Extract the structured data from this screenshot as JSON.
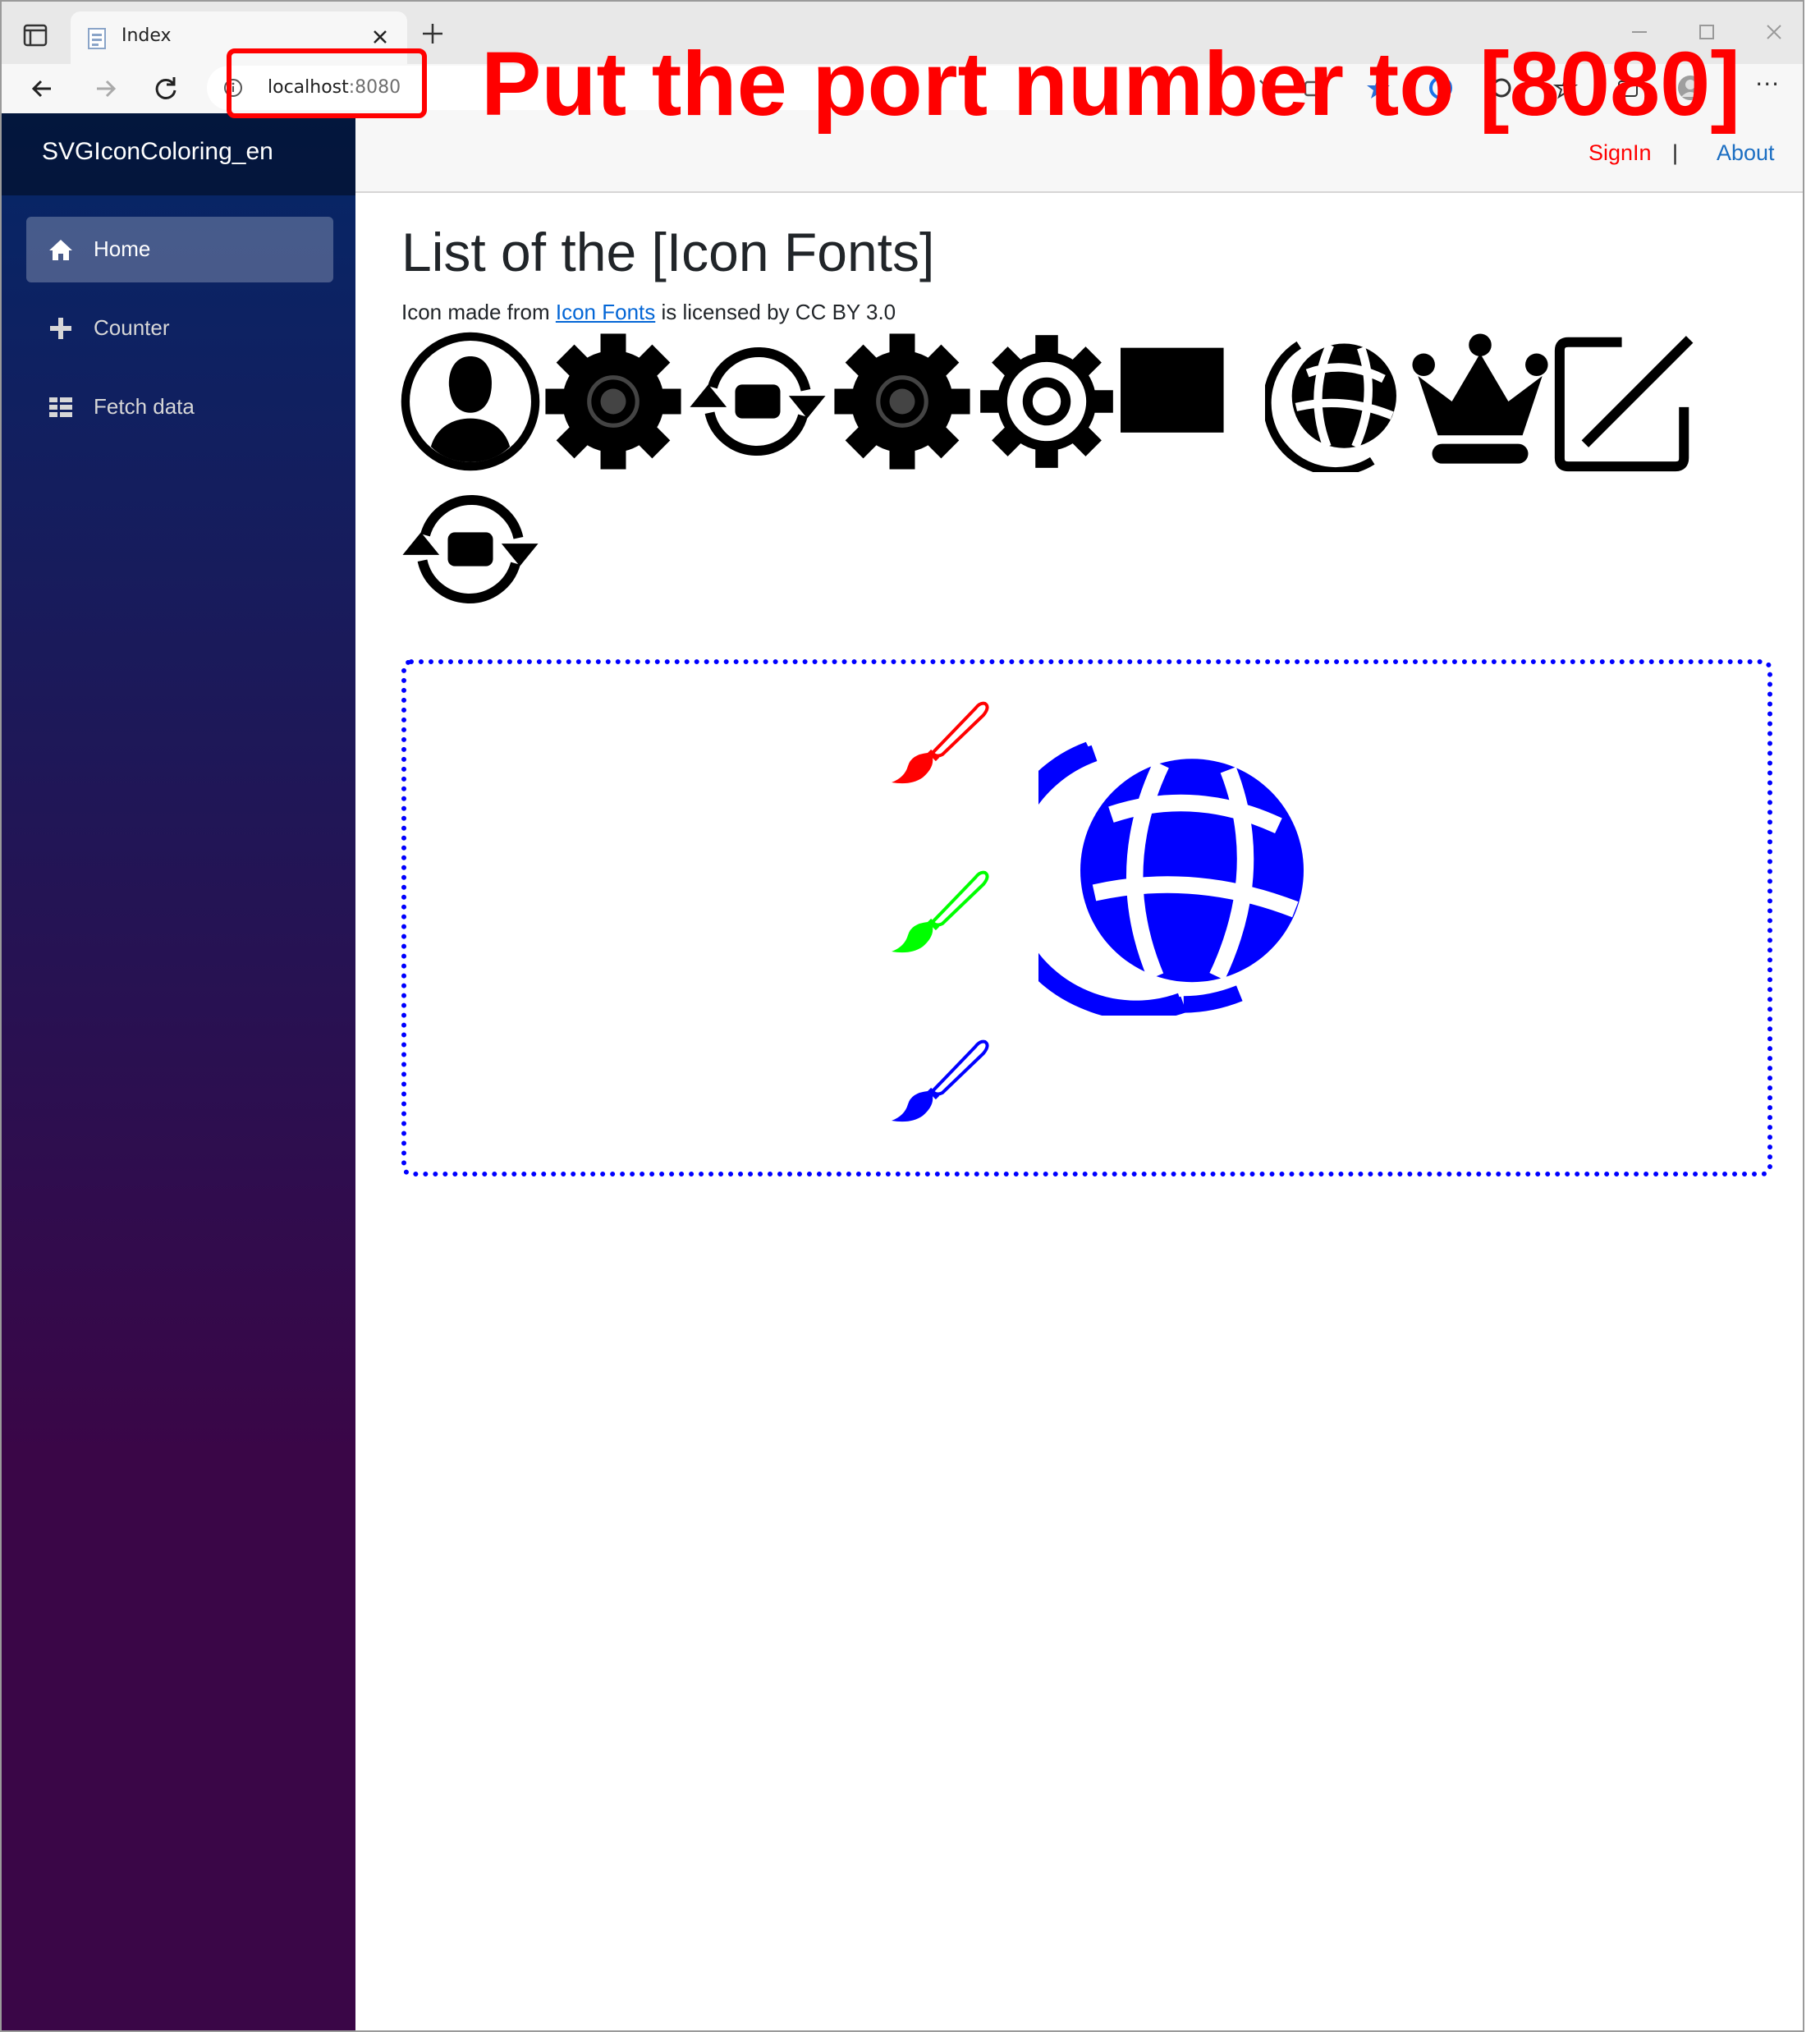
{
  "browser": {
    "tab_title": "Index",
    "url_host": "localhost",
    "url_port": ":8080",
    "more_label": "···"
  },
  "annotation": {
    "text": "Put the port number to [8080]",
    "color": "#ff0000"
  },
  "sidebar": {
    "brand": "SVGIconColoring_en",
    "items": [
      {
        "label": "Home",
        "icon": "home-icon",
        "active": true
      },
      {
        "label": "Counter",
        "icon": "plus-icon",
        "active": false
      },
      {
        "label": "Fetch data",
        "icon": "list-icon",
        "active": false
      }
    ],
    "gradient_top": "#052767",
    "gradient_bottom": "#3a0647"
  },
  "topbar": {
    "signin": "SignIn",
    "separator": "|",
    "about": "About",
    "signin_color": "#ff0000",
    "about_color": "#1b6ec2"
  },
  "main": {
    "title": "List of the [Icon Fonts]",
    "credit_prefix": "Icon made from ",
    "credit_link": "Icon Fonts",
    "credit_suffix": " is licensed by CC BY 3.0",
    "icons": [
      "user-circle-icon",
      "gear-solid-icon",
      "refresh-icon",
      "gear-solid-icon",
      "gear-outline-icon",
      "square-icon",
      "globe-icon",
      "crown-icon",
      "edit-icon",
      "refresh-icon"
    ]
  },
  "paint_panel": {
    "brushes": [
      {
        "icon": "paintbrush-icon",
        "color": "#ff0000"
      },
      {
        "icon": "paintbrush-icon",
        "color": "#00ff00"
      },
      {
        "icon": "paintbrush-icon",
        "color": "#0000ff"
      }
    ],
    "globe_icon": "globe-icon",
    "globe_color": "#0000ff",
    "border_color": "#0000ff"
  }
}
